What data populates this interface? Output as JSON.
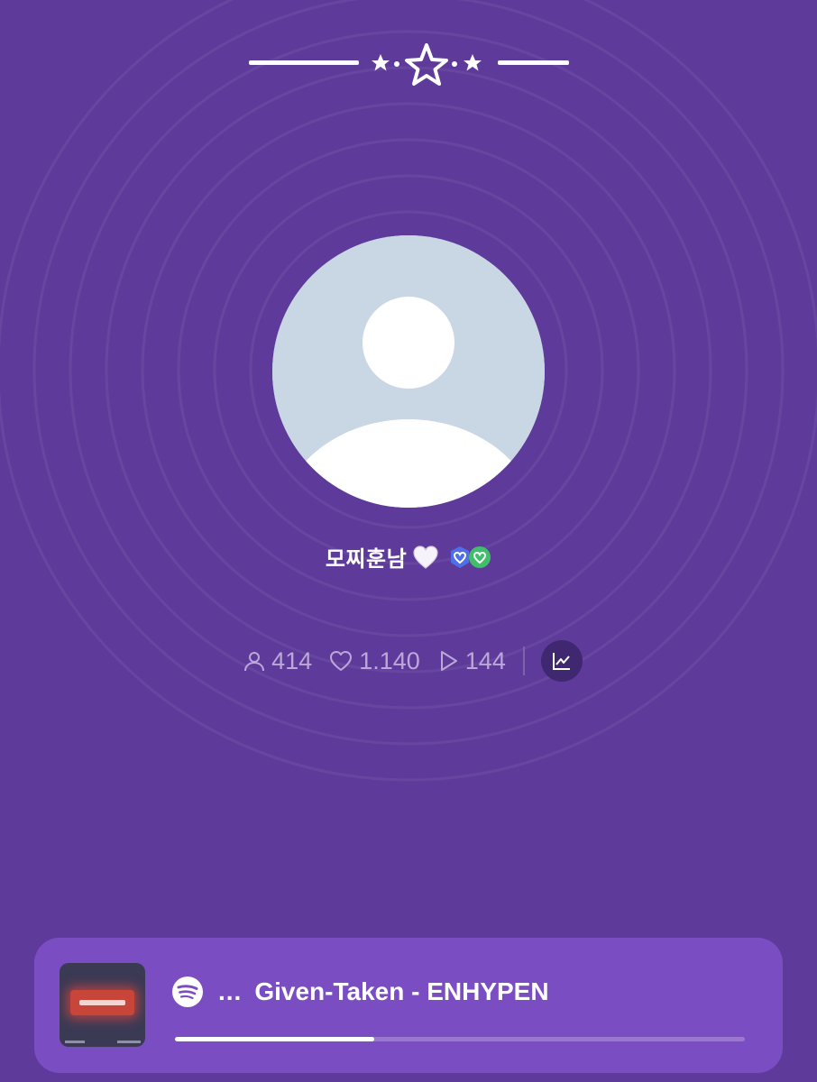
{
  "profile": {
    "username": "모찌훈남",
    "heart_emoji": "🤍",
    "badges": [
      "shield-heart-badge-blue",
      "shield-heart-badge-green"
    ]
  },
  "stats": {
    "followers": "414",
    "likes": "1.140",
    "plays": "144"
  },
  "player": {
    "ellipsis": "...",
    "track": "Given-Taken - ENHYPEN",
    "progress_fraction": 0.35
  },
  "colors": {
    "background": "#5e3b9b",
    "player_bg": "#7b4dc3",
    "avatar_bg": "#c9d6e4",
    "stat_text": "#bba8d8"
  },
  "icons": {
    "header": "star-divider-decoration",
    "followers": "person-icon",
    "likes": "heart-outline-icon",
    "plays": "play-outline-icon",
    "stats_button": "line-chart-icon",
    "source": "spotify-icon"
  }
}
